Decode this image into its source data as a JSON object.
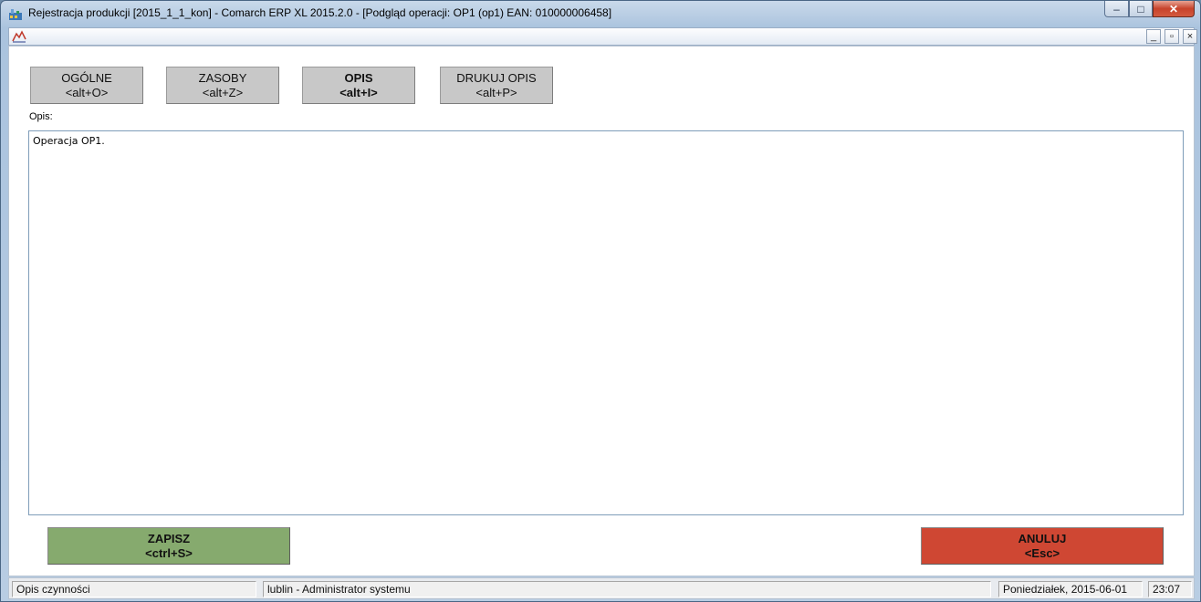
{
  "window": {
    "title": "Rejestracja produkcji [2015_1_1_kon] - Comarch ERP XL 2015.2.0 - [Podgląd operacji: OP1 (op1) EAN: 010000006458]",
    "controls": {
      "minimize": "–",
      "maximize": "□",
      "close": "✕"
    }
  },
  "mdi": {
    "minimize": "_",
    "restore": "▫",
    "close": "×"
  },
  "tabs": [
    {
      "label": "OGÓLNE",
      "shortcut": "<alt+O>"
    },
    {
      "label": "ZASOBY",
      "shortcut": "<alt+Z>"
    },
    {
      "label": "OPIS",
      "shortcut": "<alt+I>"
    },
    {
      "label": "DRUKUJ OPIS",
      "shortcut": "<alt+P>"
    }
  ],
  "opis": {
    "label": "Opis:",
    "value": "Operacja OP1."
  },
  "actions": {
    "save": {
      "label": "ZAPISZ",
      "shortcut": "<ctrl+S>"
    },
    "cancel": {
      "label": "ANULUJ",
      "shortcut": "<Esc>"
    }
  },
  "status": {
    "action": "Opis czynności",
    "user": "lublin - Administrator systemu",
    "date": "Poniedziałek, 2015-06-01",
    "time": "23:07"
  },
  "colors": {
    "save": "#86aa6e",
    "cancel": "#cf4733",
    "tab": "#c8c8c8"
  }
}
